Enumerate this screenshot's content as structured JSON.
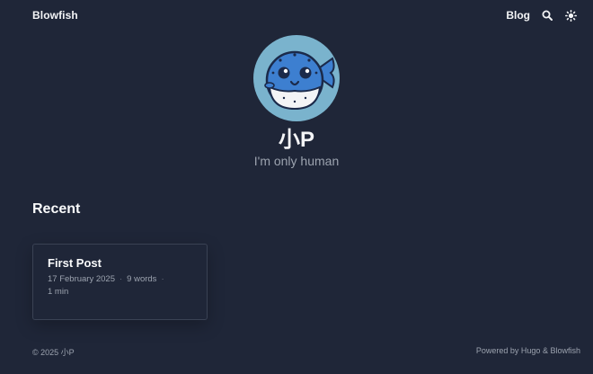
{
  "header": {
    "brand": "Blowfish",
    "nav": {
      "blog_label": "Blog",
      "search_icon": "search-icon",
      "theme_icon": "sun-icon"
    }
  },
  "profile": {
    "avatar_icon": "blowfish-avatar",
    "name": "小P",
    "headline": "I'm only human"
  },
  "recent": {
    "heading": "Recent",
    "posts": [
      {
        "title": "First Post",
        "date": "17 February 2025",
        "separator": "·",
        "words": "9 words",
        "reading_time": "1 min"
      }
    ]
  },
  "footer": {
    "copyright": "© 2025 小P",
    "powered_prefix": "Powered by",
    "hugo": "Hugo",
    "amp": "&",
    "blowfish": "Blowfish"
  },
  "colors": {
    "background": "#1f2638",
    "avatar_bg": "#7ab3cd",
    "fish_body": "#3d7fd0",
    "text_primary": "#f3f4f6",
    "text_muted": "#9ca3af"
  }
}
